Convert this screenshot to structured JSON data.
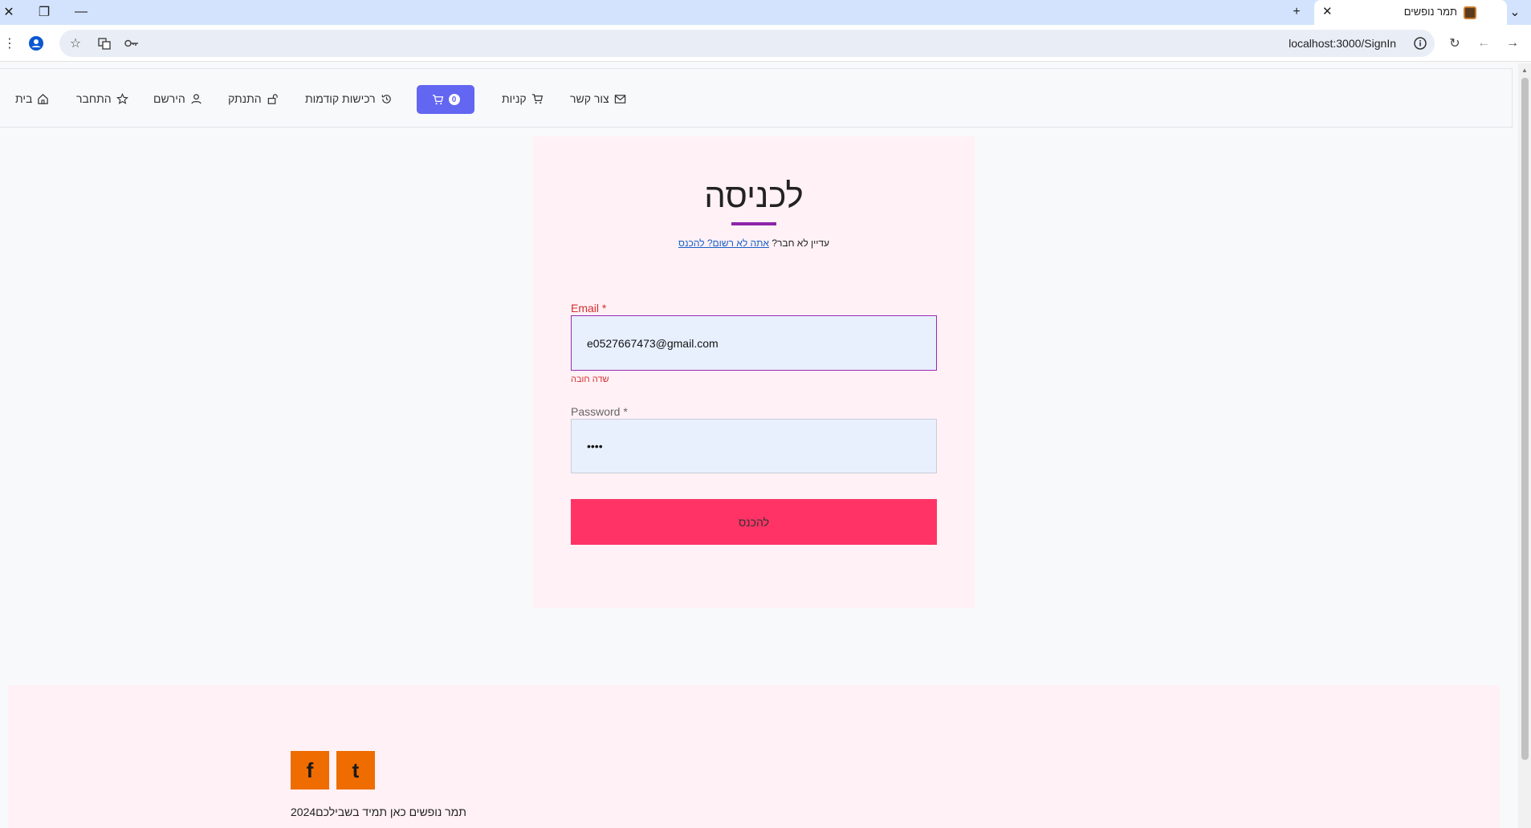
{
  "browser": {
    "tab_title": "תמר נופשים",
    "url": "localhost:3000/SignIn"
  },
  "nav": {
    "home": "בית",
    "login": "התחבר",
    "register": "הירשם",
    "logout": "התנתק",
    "previous_purchases": "רכישות קודמות",
    "cart_count": "0",
    "shopping": "קניות",
    "contact": "צור קשר"
  },
  "signin": {
    "title": "לכניסה",
    "subline_prefix": "עדיין לא חבר?",
    "subline_link": "אתה לא רשום? להכנס",
    "email_label": "Email *",
    "email_value": "e0527667473@gmail.com",
    "email_error": "שדה חובה",
    "password_label": "Password *",
    "password_value": "••••",
    "submit_label": "להכנס"
  },
  "footer": {
    "facebook_glyph": "f",
    "tumblr_glyph": "t",
    "copyright": "תמר נופשים כאן תמיד בשבילכם2024"
  },
  "colors": {
    "cart_button": "#6366f1",
    "submit_button": "#ff3366",
    "social_button": "#ef6c00",
    "error": "#d32f2f",
    "card_bg": "#fff1f5"
  }
}
